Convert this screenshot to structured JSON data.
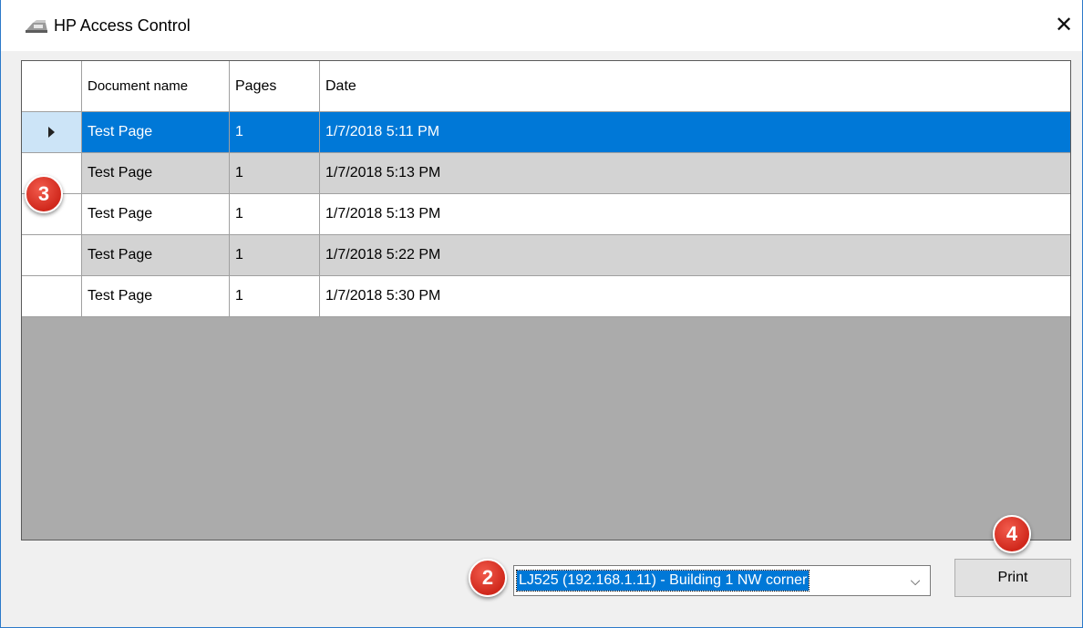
{
  "window": {
    "title": "HP Access Control",
    "close_glyph": "✕",
    "icon": "printer-icon"
  },
  "grid": {
    "columns": [
      "",
      "Document name",
      "Pages",
      "Date"
    ],
    "rows": [
      {
        "document": "Test Page",
        "pages": "1",
        "date": "1/7/2018 5:11 PM",
        "selected": true
      },
      {
        "document": "Test Page",
        "pages": "1",
        "date": "1/7/2018 5:13 PM",
        "selected": false
      },
      {
        "document": "Test Page",
        "pages": "1",
        "date": "1/7/2018 5:13 PM",
        "selected": false
      },
      {
        "document": "Test Page",
        "pages": "1",
        "date": "1/7/2018 5:22 PM",
        "selected": false
      },
      {
        "document": "Test Page",
        "pages": "1",
        "date": "1/7/2018 5:30 PM",
        "selected": false
      }
    ]
  },
  "printer_select": {
    "value": "LJ525 (192.168.1.11) - Building 1 NW corner",
    "chevron": "⌵"
  },
  "print_button": {
    "label": "Print"
  },
  "callouts": {
    "grid": "3",
    "printer": "2",
    "print": "4"
  },
  "colors": {
    "selection": "#0078d7",
    "alt_row": "#d3d3d3",
    "callout": "#d9342b",
    "grid_background": "#ababab"
  }
}
